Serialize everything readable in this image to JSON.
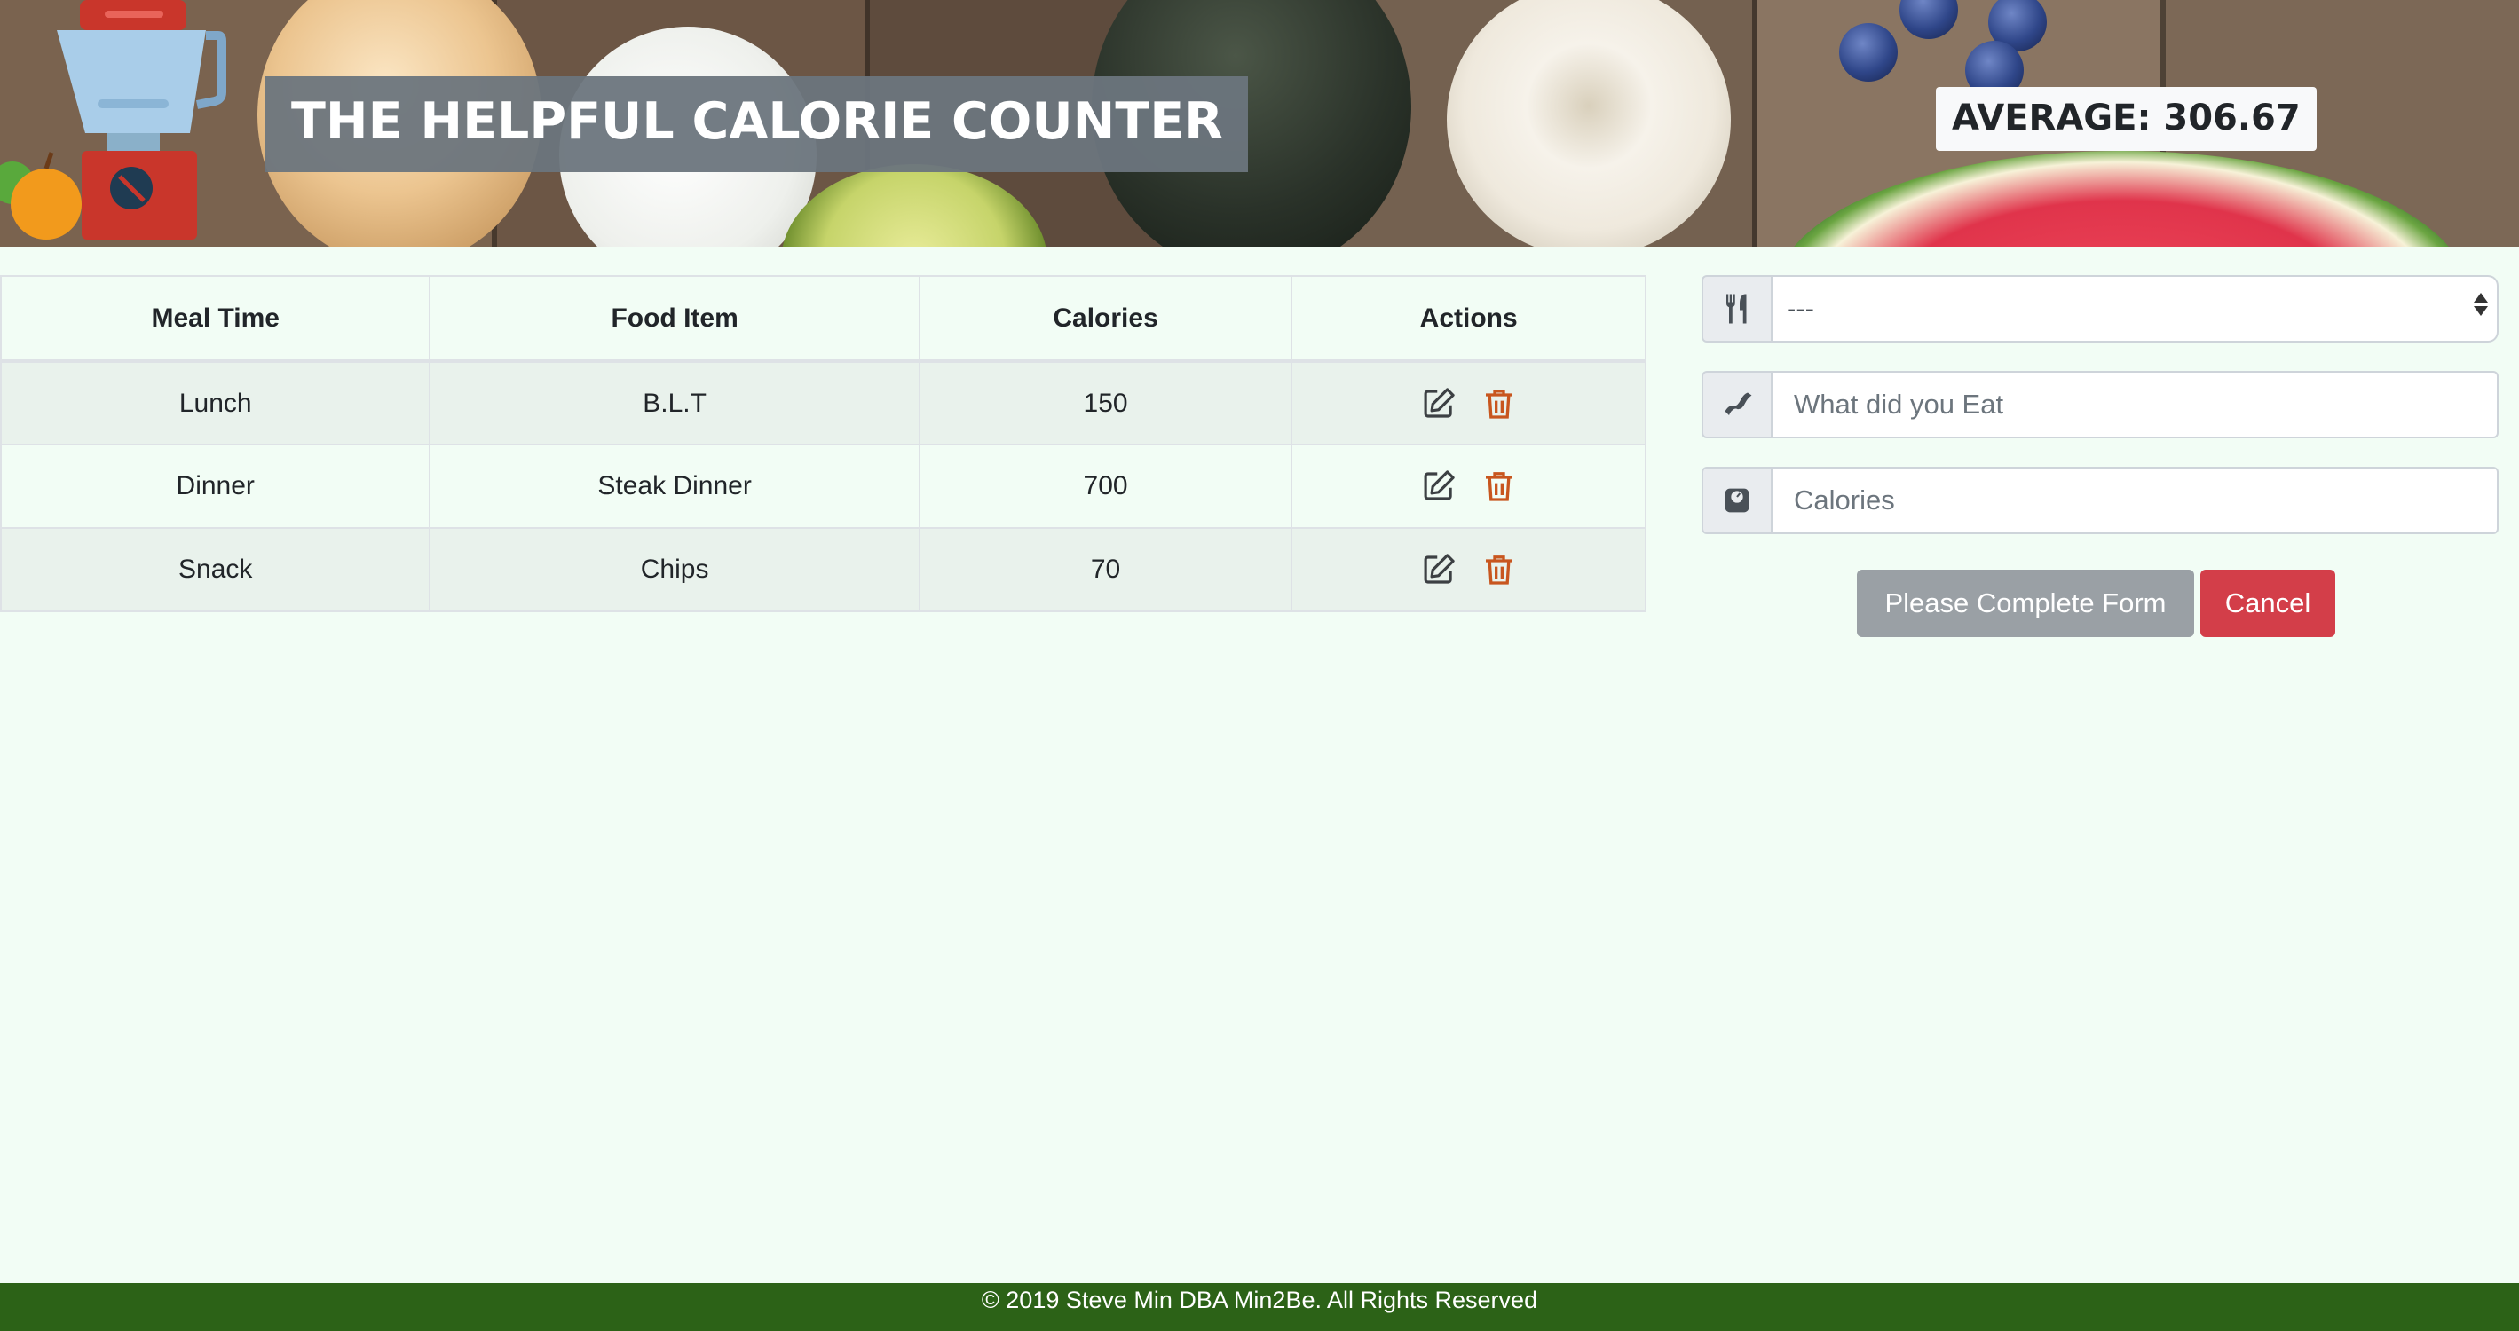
{
  "header": {
    "title": "THE HELPFUL CALORIE COUNTER",
    "average": "AVERAGE: 306.67"
  },
  "table": {
    "columns": [
      "Meal Time",
      "Food Item",
      "Calories",
      "Actions"
    ],
    "rows": [
      {
        "meal_time": "Lunch",
        "food_item": "B.L.T",
        "calories": "150"
      },
      {
        "meal_time": "Dinner",
        "food_item": "Steak Dinner",
        "calories": "700"
      },
      {
        "meal_time": "Snack",
        "food_item": "Chips",
        "calories": "70"
      }
    ]
  },
  "form": {
    "meal_select_value": "---",
    "food_placeholder": "What did you Eat",
    "calories_placeholder": "Calories",
    "submit_label": "Please Complete Form",
    "cancel_label": "Cancel"
  },
  "footer": {
    "text": "© 2019 Steve Min DBA Min2Be. All Rights Reserved"
  },
  "icons": {
    "edit": "edit-icon",
    "delete": "trash-icon",
    "meal": "utensils-icon",
    "food": "bacon-icon",
    "calories": "weight-scale-icon"
  },
  "colors": {
    "background": "#f2fdf5",
    "title_bg": "#6c757d",
    "delete_icon": "#c8561e",
    "cancel_button": "#d33e49",
    "submit_button": "#9aa0a5",
    "footer": "#2c6217"
  }
}
